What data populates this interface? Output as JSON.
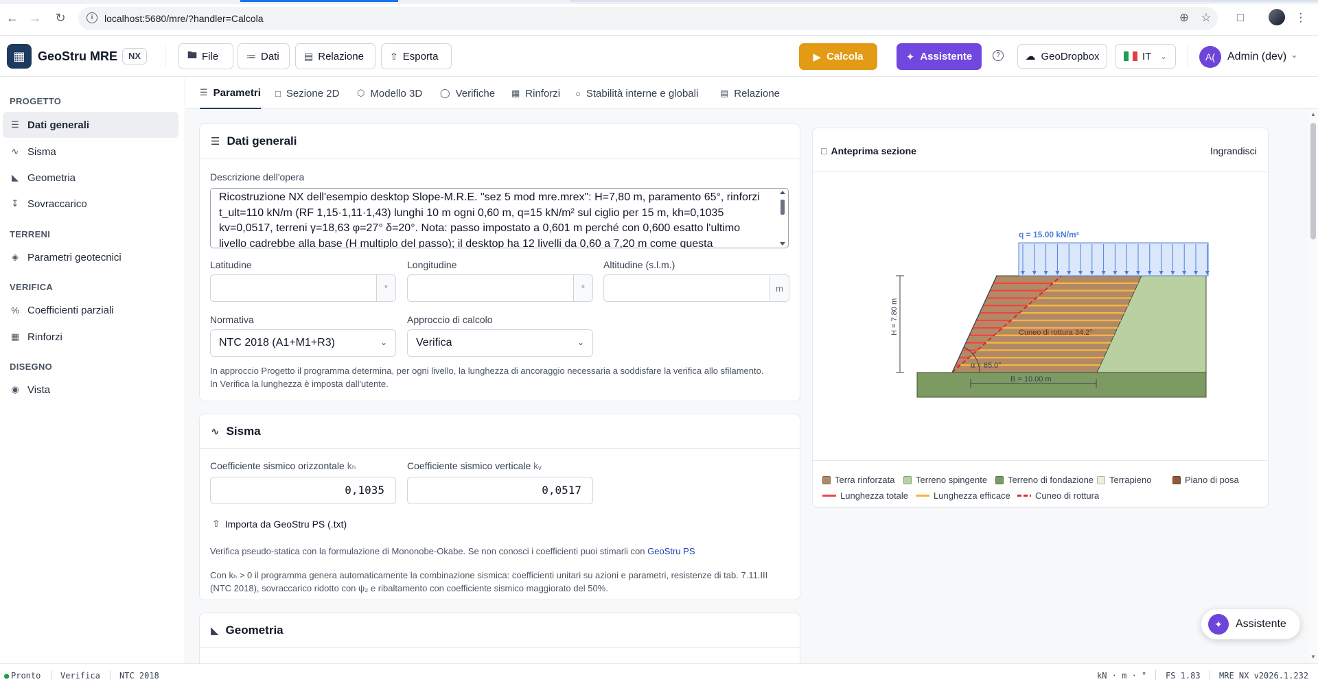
{
  "browser": {
    "url": "localhost:5680/mre/?handler=Calcola"
  },
  "header": {
    "brand": "GeoStru MRE",
    "edition": "NX",
    "menu": [
      "File",
      "Dati",
      "Relazione",
      "Esporta"
    ],
    "calcola_label": "Calcola",
    "assistente_label": "Assistente",
    "geodropbox_label": "GeoDropbox",
    "language": "IT",
    "user_initials": "A(",
    "user_name": "Admin (dev)",
    "colors": {
      "calcola": "#e39b16",
      "assistente": "#7148df",
      "brand": "#1f3a5f"
    }
  },
  "sidebar": {
    "sections": [
      {
        "title": "PROGETTO",
        "items": [
          "Dati generali",
          "Sisma",
          "Geometria",
          "Sovraccarico"
        ]
      },
      {
        "title": "TERRENI",
        "items": [
          "Parametri geotecnici"
        ]
      },
      {
        "title": "VERIFICA",
        "items": [
          "Coefficienti parziali",
          "Rinforzi"
        ]
      },
      {
        "title": "DISEGNO",
        "items": [
          "Vista"
        ]
      }
    ],
    "active": "Dati generali"
  },
  "tabs": [
    "Parametri",
    "Sezione 2D",
    "Modello 3D",
    "Verifiche",
    "Rinforzi",
    "Stabilità interne e globali",
    "Relazione"
  ],
  "dati_generali": {
    "title": "Dati generali",
    "descrizione_label": "Descrizione dell'opera",
    "descrizione": "Ricostruzione NX dell'esempio desktop Slope-M.R.E. \"sez 5 mod mre.mrex\": H=7,80 m, paramento 65°, rinforzi t_ult=110 kN/m (RF 1,15·1,11·1,43) lunghi 10 m ogni 0,60 m, q=15 kN/m² sul ciglio per 15 m, kh=0,1035 kv=0,0517, terreni γ=18,63 φ=27° δ=20°. Nota: passo impostato a 0,601 m perché con 0,600 esatto l'ultimo livello cadrebbe alla base (H multiplo del passo); il desktop ha 12 livelli da 0,60 a 7,20 m come questa",
    "latitudine_label": "Latitudine",
    "latitudine": "",
    "latitudine_unit": "°",
    "longitudine_label": "Longitudine",
    "longitudine": "",
    "longitudine_unit": "°",
    "altitudine_label": "Altitudine (s.l.m.)",
    "altitudine": "",
    "altitudine_unit": "m",
    "normativa_label": "Normativa",
    "normativa": "NTC 2018 (A1+M1+R3)",
    "approccio_label": "Approccio di calcolo",
    "approccio": "Verifica",
    "note_1": "In approccio Progetto il programma determina, per ogni livello, la lunghezza di ancoraggio necessaria a soddisfare la verifica allo sfilamento.",
    "note_2": "In Verifica la lunghezza è imposta dall'utente."
  },
  "sisma": {
    "title": "Sisma",
    "kh_label": "Coefficiente sismico orizzontale",
    "kh_sym": "kₕ",
    "kh": "0,1035",
    "kv_label": "Coefficiente sismico verticale",
    "kv_sym": "kᵥ",
    "kv": "0,0517",
    "import_label": "Importa da GeoStru PS (.txt)",
    "note_1": "Verifica pseudo-statica con la formulazione di Mononobe-Okabe. Se non conosci i coefficienti puoi stimarli con",
    "note_1_link": "GeoStru PS",
    "note_2a": "Con kₕ > 0 il programma genera automaticamente la combinazione sismica: coefficienti unitari su azioni e parametri, resistenze di tab. 7.11.III",
    "note_2b": "(NTC 2018), sovraccarico ridotto con ψ₂ e ribaltamento con coefficiente sismico maggiorato del 50%."
  },
  "geometria": {
    "title": "Geometria"
  },
  "preview": {
    "title": "Anteprima sezione",
    "enlarge_label": "Ingrandisci",
    "load_label": "q = 15.00 kN/m²",
    "height_label": "H = 7.80 m",
    "base_label": "B = 10.00 m",
    "angle_label": "α = 65.0°",
    "wedge_label": "Cuneo di rottura 34.2°",
    "legend": [
      {
        "label": "Terra rinforzata",
        "kind": "swatch",
        "color": "#b08a66"
      },
      {
        "label": "Terreno spingente",
        "kind": "swatch",
        "color": "#b9d1a1"
      },
      {
        "label": "Terreno di fondazione",
        "kind": "swatch",
        "color": "#7e9a63"
      },
      {
        "label": "Terrapieno",
        "kind": "swatch",
        "color": "#eef0df"
      },
      {
        "label": "Piano di posa",
        "kind": "swatch",
        "color": "#8d5b3a"
      },
      {
        "label": "Lunghezza totale",
        "kind": "line",
        "color": "#ef4444"
      },
      {
        "label": "Lunghezza efficace",
        "kind": "line",
        "color": "#f5b342"
      },
      {
        "label": "Cuneo di rottura",
        "kind": "dash",
        "color": "#dc2626"
      }
    ]
  },
  "fab_label": "Assistente",
  "status": {
    "state": "Pronto",
    "mode": "Verifica",
    "norm": "NTC 2018",
    "units": "kN · m · °",
    "fs": "FS 1.83",
    "version": "MRE NX v2026.1.232"
  }
}
